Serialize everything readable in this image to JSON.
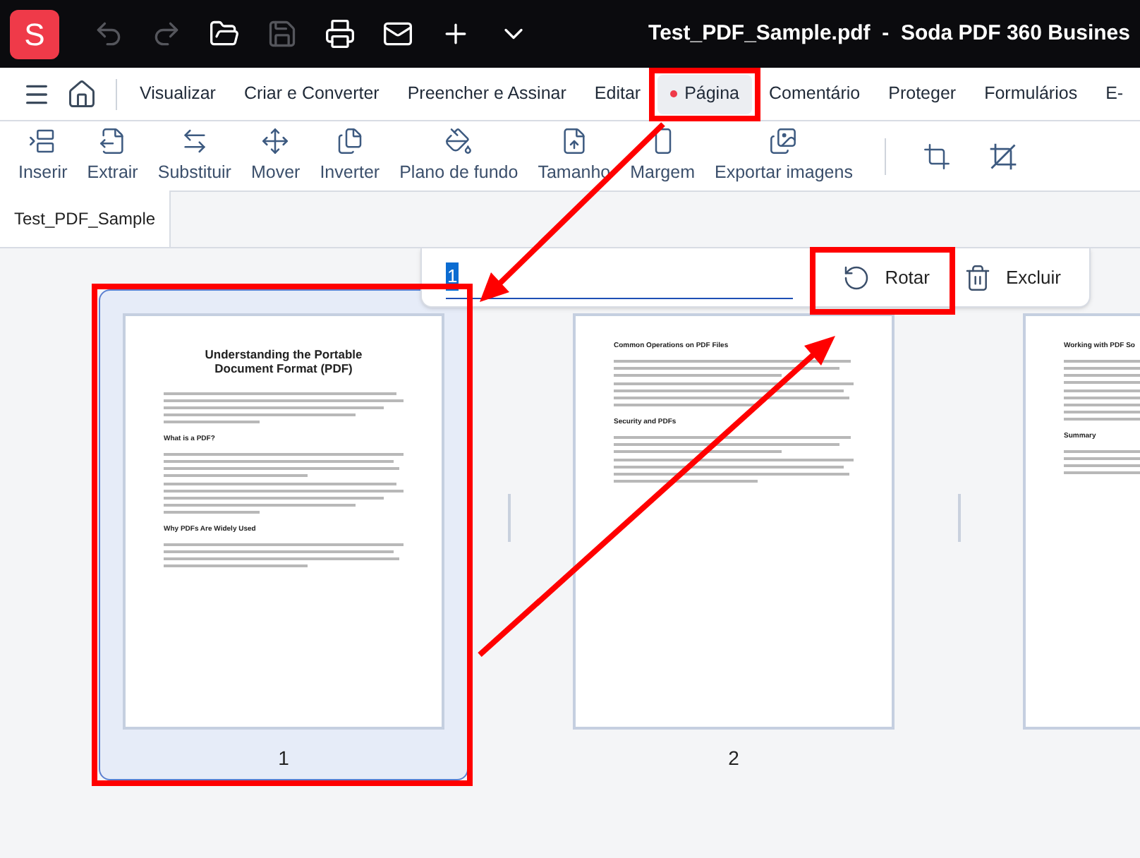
{
  "title_bar": {
    "logo": "S",
    "title": "Test_PDF_Sample.pdf  -  Soda PDF 360 Busines",
    "actions": [
      {
        "disabled": true
      },
      {
        "disabled": true
      },
      {
        "disabled": false
      },
      {
        "disabled": true
      },
      {
        "disabled": false
      },
      {
        "disabled": false
      },
      {
        "disabled": false
      },
      {
        "disabled": false
      }
    ]
  },
  "menu_tabs": [
    {
      "label": "Visualizar",
      "selected": false
    },
    {
      "label": "Criar e Converter",
      "selected": false
    },
    {
      "label": "Preencher e Assinar",
      "selected": false
    },
    {
      "label": "Editar",
      "selected": false
    },
    {
      "label": "Página",
      "selected": true
    },
    {
      "label": "Comentário",
      "selected": false
    },
    {
      "label": "Proteger",
      "selected": false
    },
    {
      "label": "Formulários",
      "selected": false
    },
    {
      "label": "E-",
      "selected": false
    }
  ],
  "toolbar": [
    {
      "label": "Inserir"
    },
    {
      "label": "Extrair"
    },
    {
      "label": "Substituir"
    },
    {
      "label": "Mover"
    },
    {
      "label": "Inverter"
    },
    {
      "label": "Plano de fundo"
    },
    {
      "label": "Tamanho"
    },
    {
      "label": "Margem"
    },
    {
      "label": "Exportar imagens"
    }
  ],
  "document_tab": {
    "label": "Test_PDF_Sample"
  },
  "page_bar": {
    "page_field": {
      "value": "1"
    },
    "buttons": [
      {
        "label": "Rotar"
      },
      {
        "label": "Excluir"
      }
    ]
  },
  "pages": [
    {
      "number": "1",
      "selected": true,
      "blocks": [
        {
          "kind": "title",
          "text": "Understanding the Portable Document Format (PDF)"
        },
        {
          "kind": "paragraph"
        },
        {
          "kind": "heading",
          "text": "What is a PDF?"
        },
        {
          "kind": "paragraph"
        },
        {
          "kind": "paragraph"
        },
        {
          "kind": "heading",
          "text": "Why PDFs Are Widely Used"
        },
        {
          "kind": "paragraph"
        }
      ]
    },
    {
      "number": "2",
      "selected": false,
      "blocks": [
        {
          "kind": "heading",
          "text": "Common Operations on PDF Files"
        },
        {
          "kind": "paragraph"
        },
        {
          "kind": "paragraph"
        },
        {
          "kind": "heading",
          "text": "Security and PDFs"
        },
        {
          "kind": "paragraph"
        },
        {
          "kind": "paragraph"
        }
      ]
    },
    {
      "selected": false,
      "blocks": [
        {
          "kind": "heading",
          "text": "Working with PDF So"
        },
        {
          "kind": "paragraph"
        },
        {
          "kind": "paragraph"
        },
        {
          "kind": "heading",
          "text": "Summary"
        },
        {
          "kind": "paragraph"
        }
      ]
    }
  ]
}
